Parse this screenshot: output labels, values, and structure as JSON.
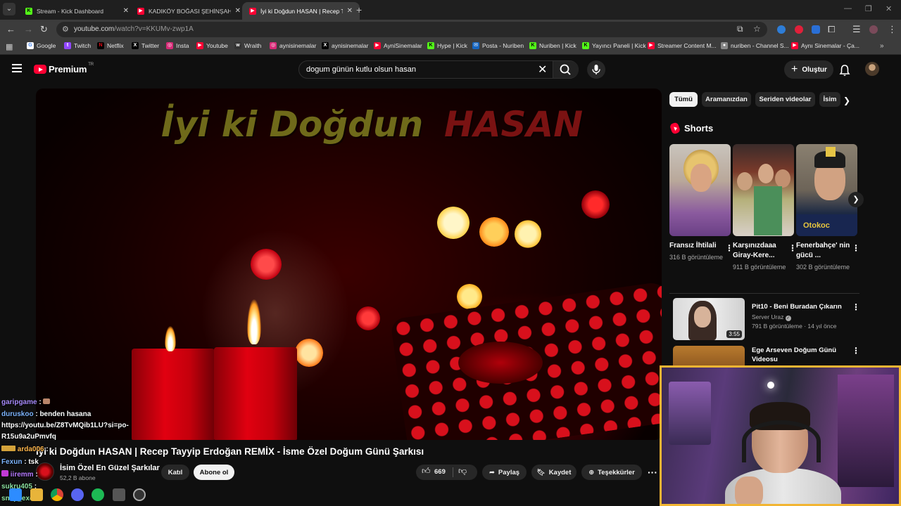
{
  "browser": {
    "tabs": [
      {
        "title": "Stream - Kick Dashboard",
        "favicon": "kick-icon",
        "active": false
      },
      {
        "title": "KADIKÖY BOĞASI ŞEHİNŞAH VE",
        "favicon": "youtube-icon",
        "active": false
      },
      {
        "title": "İyi ki Doğdun HASAN | Recep T",
        "favicon": "youtube-icon",
        "active": true
      }
    ],
    "url_host": "youtube.com",
    "url_path": "/watch?v=KKUMv-zwp1A",
    "bookmarks": [
      {
        "label": "Google"
      },
      {
        "label": "Twitch"
      },
      {
        "label": "Netflix"
      },
      {
        "label": "Twitter"
      },
      {
        "label": "Insta"
      },
      {
        "label": "Youtube"
      },
      {
        "label": "Wraith"
      },
      {
        "label": "aynisinemalar"
      },
      {
        "label": "aynisinemalar"
      },
      {
        "label": "AyniSinemalar"
      },
      {
        "label": "Hype | Kick"
      },
      {
        "label": "Posta - Nuriben"
      },
      {
        "label": "Nuriben | Kick"
      },
      {
        "label": "Yayıncı Paneli | Kick"
      },
      {
        "label": "Streamer Content M..."
      },
      {
        "label": "nuriben - Channel S..."
      },
      {
        "label": "Aynı Sinemalar - Ça..."
      }
    ]
  },
  "youtube": {
    "logo_text": "Premium",
    "logo_region": "TR",
    "search_query": "dogum günün kutlu olsun hasan",
    "create_label": "Oluştur"
  },
  "video": {
    "overlay_text_1": "İyi ki Doğdun",
    "overlay_text_2": "HASAN",
    "title": "İyi ki Doğdun HASAN | Recep Tayyip Erdoğan REMİX - İsme Özel Doğum Günü Şarkısı",
    "channel_name": "İsim Özel En Güzel Şarkılar",
    "subscribers": "52,2 B abone",
    "join_label": "Katıl",
    "subscribe_label": "Abone ol",
    "likes": "669",
    "share_label": "Paylaş",
    "save_label": "Kaydet",
    "thanks_label": "Teşekkürler"
  },
  "sidebar": {
    "chips": [
      "Tümü",
      "Aramanızdan",
      "Seriden videolar",
      "İsim"
    ],
    "shorts_title": "Shorts",
    "shorts": [
      {
        "title": "Fransız İhtilali",
        "views": "316 B görüntüleme"
      },
      {
        "title": "Karşınızdaaa Giray-Kere...",
        "views": "911 B görüntüleme"
      },
      {
        "title": "Fenerbahçe' nin gücü ...",
        "views": "302 B görüntüleme"
      }
    ],
    "recommended": [
      {
        "title": "Pit10 - Beni Buradan Çıkarın",
        "channel": "Server Uraz",
        "meta": "791 B görüntüleme · 14 yıl önce",
        "duration": "3:55"
      },
      {
        "title": "Ege Arseven Doğum Günü Videosu",
        "channel": "",
        "meta": "",
        "duration": ""
      }
    ]
  },
  "chat": [
    {
      "user": "garipgame",
      "text": ""
    },
    {
      "user": "duruskoo",
      "text": "benden hasana"
    },
    {
      "user": "",
      "text": "https://youtu.be/Z8TvMQib1LU?si=po-"
    },
    {
      "user": "",
      "text": "R15u9a2uPmvfq"
    },
    {
      "user": "arda006",
      "text": ""
    },
    {
      "user": "Fexun",
      "text": "tsk"
    },
    {
      "user": "iiremm",
      "text": ""
    },
    {
      "user": "sukru405",
      "text": ""
    },
    {
      "user": "snap_exe",
      "text": ""
    }
  ],
  "colors": {
    "youtube_red": "#ff0033",
    "kick_green": "#53fc18",
    "webcam_border": "#f2b533"
  }
}
